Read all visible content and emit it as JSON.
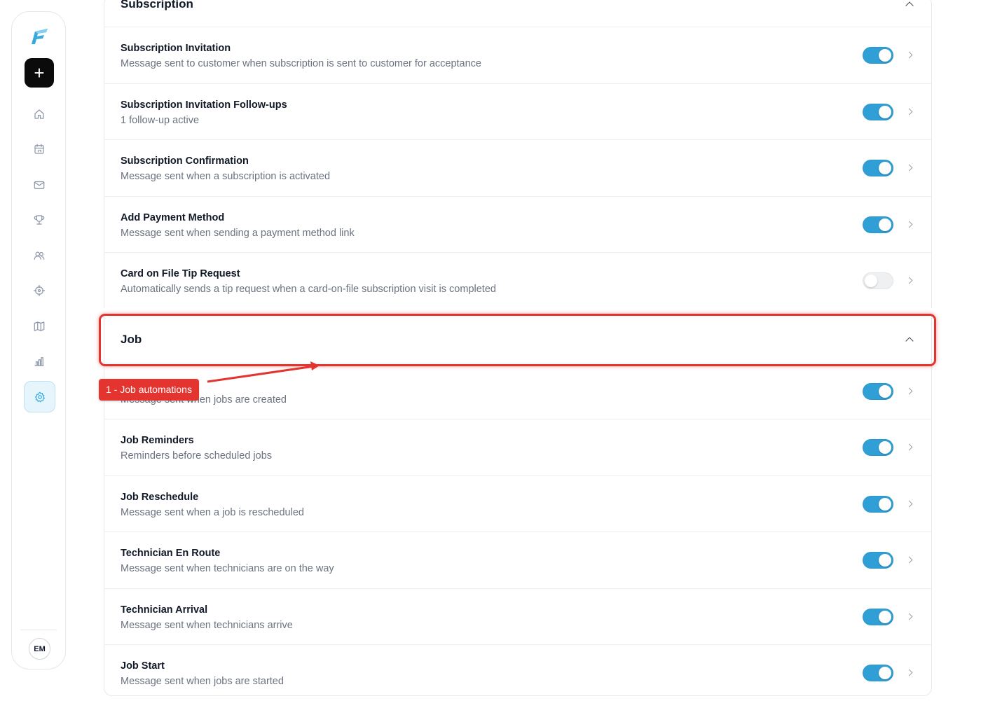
{
  "sidebar": {
    "avatar_initials": "EM",
    "nav": [
      "home-icon",
      "calendar-icon",
      "mail-icon",
      "trophy-icon",
      "users-icon",
      "target-icon",
      "map-icon",
      "chart-icon",
      "gear-icon"
    ],
    "active": "gear-icon",
    "accent": "#39a9dc"
  },
  "subscription": {
    "title": "Subscription",
    "items": [
      {
        "title": "Subscription Invitation",
        "desc": "Message sent to customer when subscription is sent to customer for acceptance",
        "enabled": true
      },
      {
        "title": "Subscription Invitation Follow-ups",
        "desc": "1 follow-up active",
        "enabled": true
      },
      {
        "title": "Subscription Confirmation",
        "desc": "Message sent when a subscription is activated",
        "enabled": true
      },
      {
        "title": "Add Payment Method",
        "desc": "Message sent when sending a payment method link",
        "enabled": true
      },
      {
        "title": "Card on File Tip Request",
        "desc": "Automatically sends a tip request when a card-on-file subscription visit is completed",
        "enabled": false
      }
    ]
  },
  "job": {
    "title": "Job",
    "items": [
      {
        "title": "",
        "desc": "Message sent when jobs are created",
        "enabled": true
      },
      {
        "title": "Job Reminders",
        "desc": "Reminders before scheduled jobs",
        "enabled": true
      },
      {
        "title": "Job Reschedule",
        "desc": "Message sent when a job is rescheduled",
        "enabled": true
      },
      {
        "title": "Technician En Route",
        "desc": "Message sent when technicians are on the way",
        "enabled": true
      },
      {
        "title": "Technician Arrival",
        "desc": "Message sent when technicians arrive",
        "enabled": true
      },
      {
        "title": "Job Start",
        "desc": "Message sent when jobs are started",
        "enabled": true
      }
    ]
  },
  "annotation": {
    "label": "1 - Job automations",
    "color": "#e3342f"
  },
  "colors": {
    "toggle_on": "#2f9fd6",
    "toggle_off": "#eef0f2"
  }
}
